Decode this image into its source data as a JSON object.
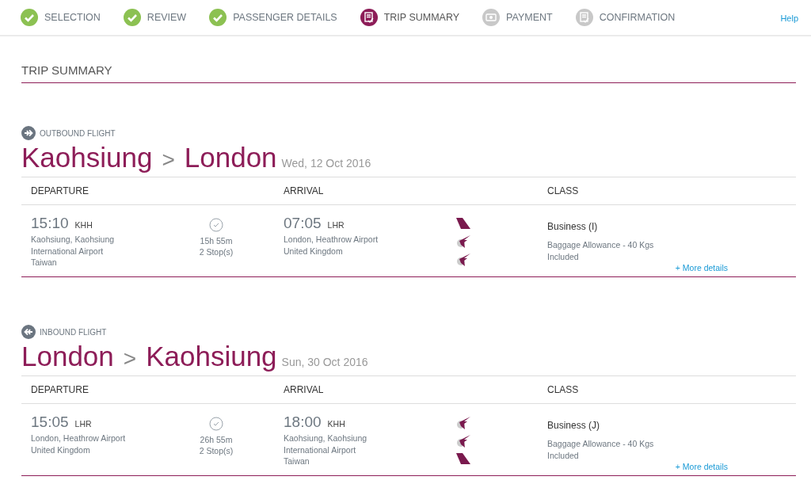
{
  "steps": [
    {
      "label": "SELECTION",
      "kind": "check",
      "completed": true,
      "selected": false
    },
    {
      "label": "REVIEW",
      "kind": "check",
      "completed": true,
      "selected": false
    },
    {
      "label": "PASSENGER DETAILS",
      "kind": "check",
      "completed": true,
      "selected": false
    },
    {
      "label": "TRIP SUMMARY",
      "kind": "document",
      "completed": false,
      "selected": true
    },
    {
      "label": "PAYMENT",
      "kind": "cash",
      "completed": false,
      "selected": false
    },
    {
      "label": "CONFIRMATION",
      "kind": "document",
      "completed": false,
      "selected": false
    }
  ],
  "help": "Help",
  "page_title": "TRIP SUMMARY",
  "flights": [
    {
      "kind": "outbound",
      "label": "OUTBOUND FLIGHT",
      "origin": "Kaohsiung",
      "separator": ">",
      "destination": "London",
      "date": "Wed, 12 Oct 2016",
      "columns": [
        "DEPARTURE",
        "ARRIVAL",
        "CLASS"
      ],
      "departure": {
        "time": "15:10",
        "code": "KHH",
        "lines": [
          "Kaohsiung, Kaohsiung",
          "International Airport",
          "Taiwan"
        ]
      },
      "duration": "15h 55m",
      "stops": "2 Stop(s)",
      "arrival": {
        "time": "07:05",
        "code": "LHR",
        "lines": [
          "London, Heathrow Airport",
          "United Kingdom"
        ]
      },
      "airline_icons": [
        {
          "kind": "tail"
        },
        {
          "kind": "logo"
        },
        {
          "kind": "logo"
        }
      ],
      "class": "Business (I)",
      "baggage": [
        "Baggage Allowance - 40 Kgs",
        "Included"
      ],
      "more_details": "+ More details"
    },
    {
      "kind": "inbound",
      "label": "INBOUND FLIGHT",
      "origin": "London",
      "separator": ">",
      "destination": "Kaohsiung",
      "date": "Sun, 30 Oct 2016",
      "columns": [
        "DEPARTURE",
        "ARRIVAL",
        "CLASS"
      ],
      "departure": {
        "time": "15:05",
        "code": "LHR",
        "lines": [
          "London, Heathrow Airport",
          "United Kingdom"
        ]
      },
      "duration": "26h 55m",
      "stops": "2 Stop(s)",
      "arrival": {
        "time": "18:00",
        "code": "KHH",
        "lines": [
          "Kaohsiung, Kaohsiung",
          "International Airport",
          "Taiwan"
        ]
      },
      "airline_icons": [
        {
          "kind": "logo"
        },
        {
          "kind": "logo"
        },
        {
          "kind": "tail"
        }
      ],
      "class": "Business (J)",
      "baggage": [
        "Baggage Allowance - 40 Kgs",
        "Included"
      ],
      "more_details": "+ More details"
    }
  ]
}
